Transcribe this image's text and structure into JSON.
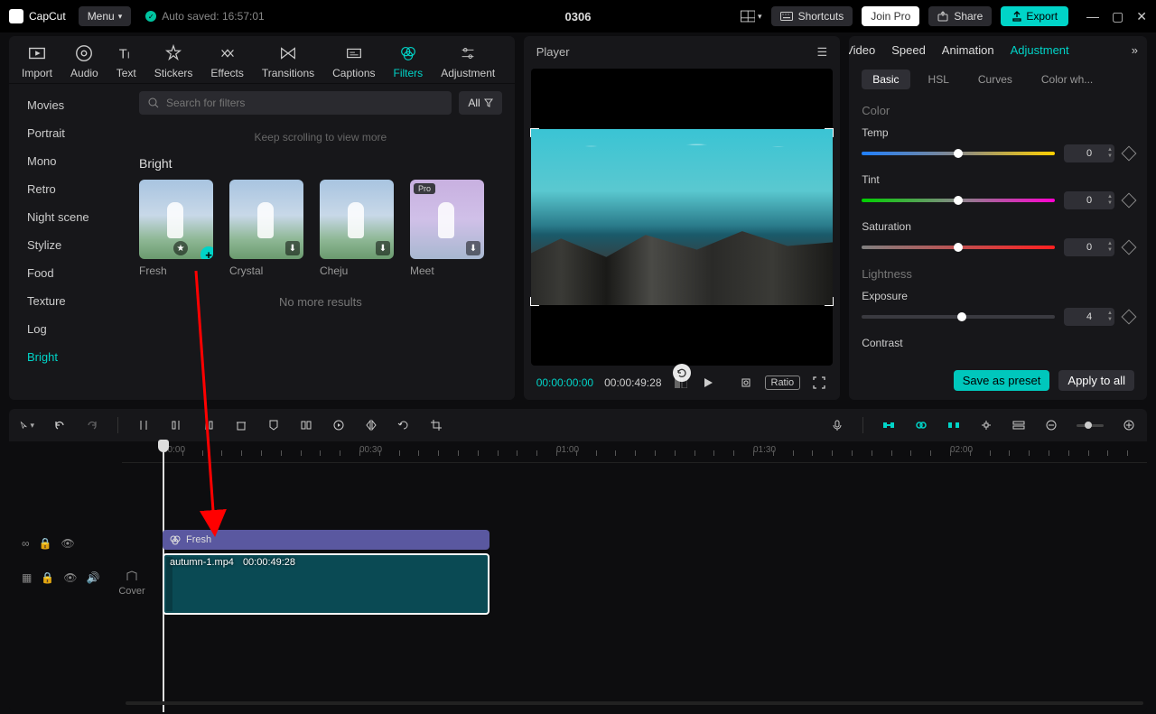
{
  "app": {
    "name": "CapCut"
  },
  "topbar": {
    "menu_label": "Menu",
    "autosave": "Auto saved: 16:57:01",
    "project_title": "0306",
    "shortcuts": "Shortcuts",
    "join_pro": "Join Pro",
    "share": "Share",
    "export": "Export"
  },
  "tools": {
    "import": "Import",
    "audio": "Audio",
    "text": "Text",
    "stickers": "Stickers",
    "effects": "Effects",
    "transitions": "Transitions",
    "captions": "Captions",
    "filters": "Filters",
    "adjustment": "Adjustment"
  },
  "categories": [
    "Movies",
    "Portrait",
    "Mono",
    "Retro",
    "Night scene",
    "Stylize",
    "Food",
    "Texture",
    "Log",
    "Bright"
  ],
  "filters_panel": {
    "search_placeholder": "Search for filters",
    "all_label": "All",
    "scroll_hint": "Keep scrolling to view more",
    "section": "Bright",
    "items": [
      {
        "label": "Fresh",
        "pro": false
      },
      {
        "label": "Crystal",
        "pro": false
      },
      {
        "label": "Cheju",
        "pro": false
      },
      {
        "label": "Meet",
        "pro": true
      }
    ],
    "no_more": "No more results"
  },
  "player": {
    "title": "Player",
    "time_cur": "00:00:00:00",
    "time_dur": "00:00:49:28",
    "ratio": "Ratio"
  },
  "inspector": {
    "tabs": [
      "Video",
      "Speed",
      "Animation",
      "Adjustment"
    ],
    "subtabs": [
      "Basic",
      "HSL",
      "Curves",
      "Color wh..."
    ],
    "color_label": "Color",
    "lightness_label": "Lightness",
    "params": {
      "temp": {
        "label": "Temp",
        "value": "0"
      },
      "tint": {
        "label": "Tint",
        "value": "0"
      },
      "saturation": {
        "label": "Saturation",
        "value": "0"
      },
      "exposure": {
        "label": "Exposure",
        "value": "4"
      },
      "contrast": {
        "label": "Contrast"
      }
    },
    "save_preset": "Save as preset",
    "apply_all": "Apply to all"
  },
  "timeline": {
    "cover": "Cover",
    "ticks": [
      "00:00",
      "00:30",
      "01:00",
      "01:30",
      "02:00"
    ],
    "filter_clip": "Fresh",
    "video_clip": {
      "name": "autumn-1.mp4",
      "dur": "00:00:49:28"
    }
  }
}
